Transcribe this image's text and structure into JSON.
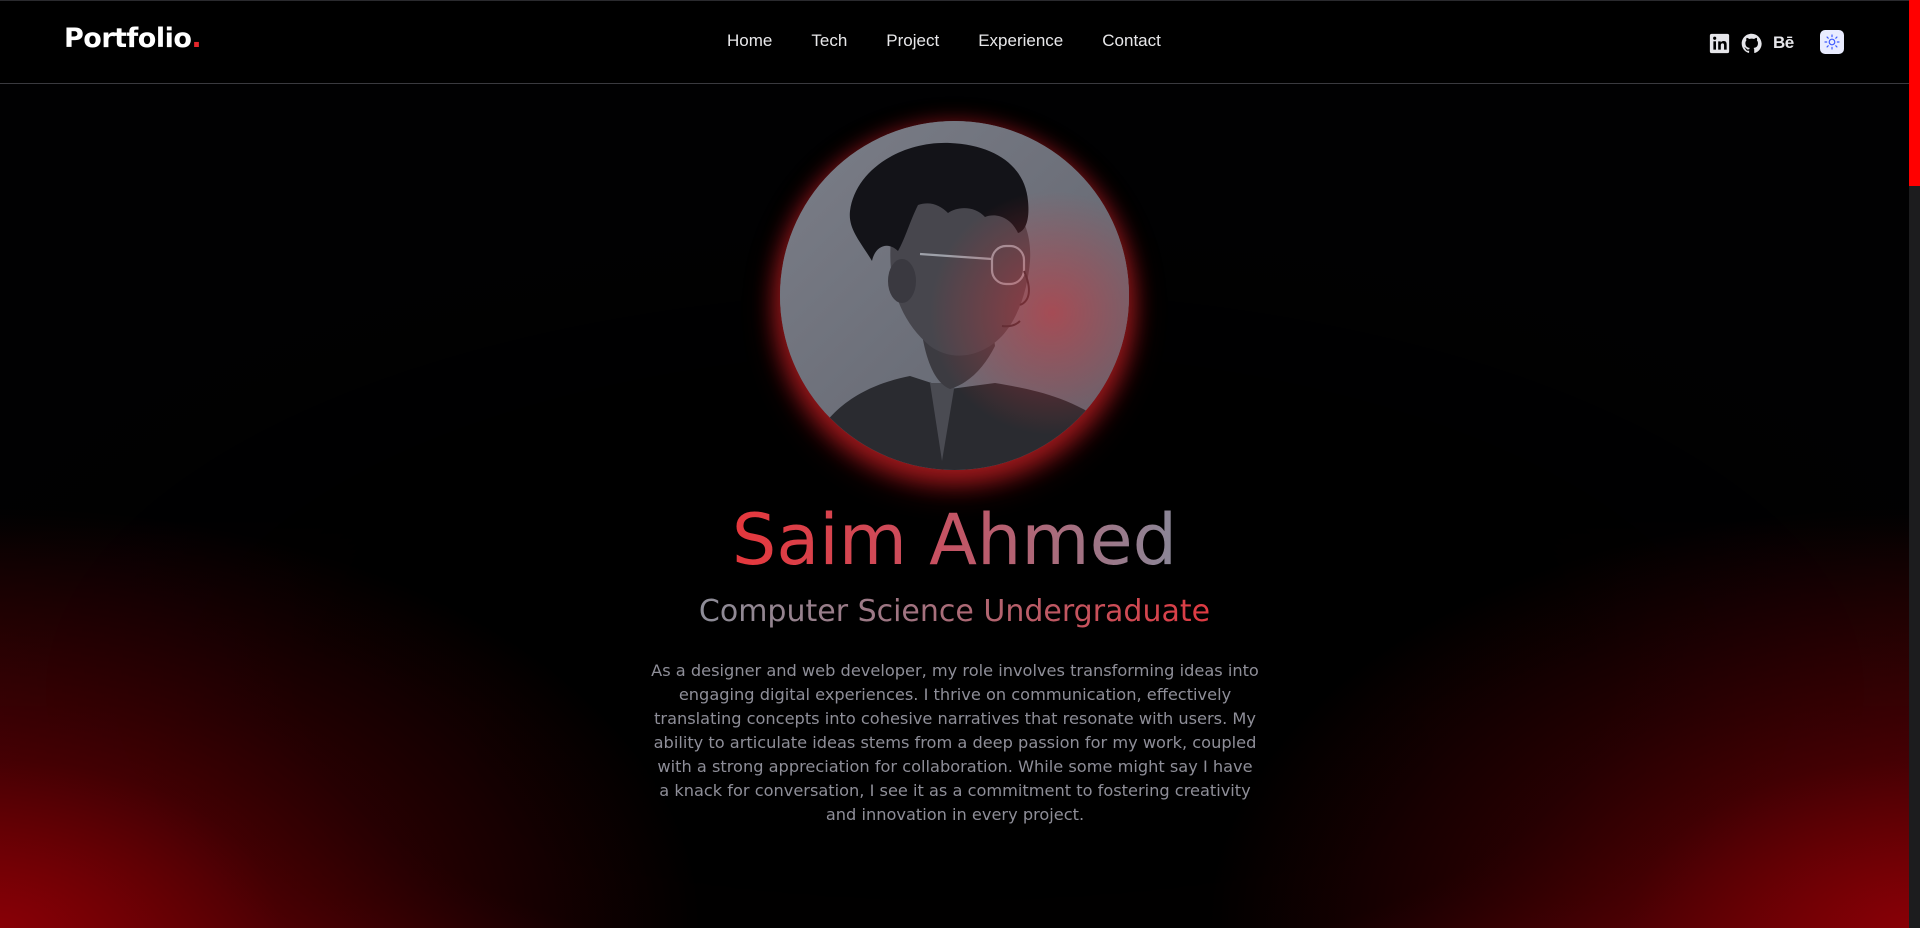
{
  "brand": {
    "logo_text": "Portfolio",
    "logo_dot": ".",
    "accent": "#e5262b"
  },
  "nav": {
    "items": [
      {
        "label": "Home"
      },
      {
        "label": "Tech"
      },
      {
        "label": "Project"
      },
      {
        "label": "Experience"
      },
      {
        "label": "Contact"
      }
    ]
  },
  "social": {
    "linkedin_icon": "linkedin-icon",
    "github_icon": "github-icon",
    "behance_label": "Bē",
    "theme_toggle_icon": "sun-icon"
  },
  "hero": {
    "avatar_icon": "profile-photo",
    "name": "Saim Ahmed",
    "subtitle": "Computer Science Undergraduate",
    "bio": "As a designer and web developer, my role involves transforming ideas into engaging digital experiences. I thrive on communication, effectively translating concepts into cohesive narratives that resonate with users. My ability to articulate ideas stems from a deep passion for my work, coupled with a strong appreciation for collaboration. While some might say I have a knack for conversation, I see it as a commitment to fostering creativity and innovation in every project."
  },
  "colors": {
    "background": "#000000",
    "scrollbar_thumb": "#ff0000",
    "text_muted": "#8e8e98"
  }
}
